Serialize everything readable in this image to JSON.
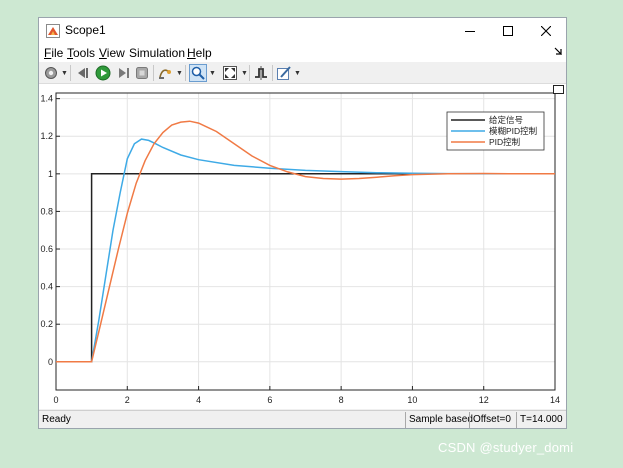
{
  "window": {
    "title": "Scope1",
    "controls": {
      "minimize": "—",
      "maximize": "☐",
      "close": "✕"
    }
  },
  "menu": {
    "items": [
      {
        "label": "File",
        "underline": "F",
        "rest": "ile"
      },
      {
        "label": "Tools",
        "underline": "T",
        "rest": "ools"
      },
      {
        "label": "View",
        "underline": "V",
        "rest": "iew"
      },
      {
        "label": "Simulation",
        "underline": "",
        "rest": "Simulation"
      },
      {
        "label": "Help",
        "underline": "H",
        "rest": "elp"
      }
    ]
  },
  "toolbar": {
    "icons": [
      "gear-icon",
      "rewind-icon",
      "run-icon",
      "step-forward-icon",
      "stop-icon",
      "highlight-icon",
      "zoom-icon",
      "fit-to-view-icon",
      "triggers-icon",
      "style-icon"
    ]
  },
  "status": {
    "state": "Ready",
    "sample_mode": "Sample based",
    "offset": "Offset=0",
    "time": "T=14.000"
  },
  "watermark": "CSDN @studyer_domi",
  "chart_data": {
    "type": "line",
    "xlim": [
      0,
      14
    ],
    "ylim": [
      -0.15,
      1.43
    ],
    "xticks": [
      0,
      2,
      4,
      6,
      8,
      10,
      12,
      14
    ],
    "yticks": [
      0,
      0.2,
      0.4,
      0.6,
      0.8,
      1,
      1.2,
      1.4
    ],
    "xtick_labels": [
      "0",
      "2",
      "4",
      "6",
      "8",
      "10",
      "12",
      "14"
    ],
    "ytick_labels": [
      "0",
      "0.2",
      "0.4",
      "0.6",
      "0.8",
      "1",
      "1.2",
      "1.4"
    ],
    "grid": true,
    "legend_placement": "top-right",
    "series": [
      {
        "name": "给定信号",
        "color": "#222222",
        "x": [
          0,
          1,
          1,
          14
        ],
        "y": [
          0,
          0,
          1,
          1
        ]
      },
      {
        "name": "模糊PID控制",
        "color": "#3eaae6",
        "x": [
          0,
          1,
          1.2,
          1.4,
          1.6,
          1.8,
          2.0,
          2.2,
          2.4,
          2.6,
          2.8,
          3.0,
          3.5,
          4.0,
          5.0,
          6.0,
          7.0,
          8.0,
          9.0,
          10.0,
          11.0,
          12.0,
          14.0
        ],
        "y": [
          0,
          0,
          0.22,
          0.46,
          0.7,
          0.9,
          1.08,
          1.16,
          1.185,
          1.178,
          1.16,
          1.14,
          1.1,
          1.075,
          1.045,
          1.03,
          1.018,
          1.012,
          1.006,
          1.003,
          1.001,
          1.0,
          1.0
        ]
      },
      {
        "name": "PID控制",
        "color": "#f07a45",
        "x": [
          0,
          1,
          1.25,
          1.5,
          1.75,
          2.0,
          2.25,
          2.5,
          2.75,
          3.0,
          3.25,
          3.5,
          3.75,
          4.0,
          4.5,
          5.0,
          5.5,
          6.0,
          6.5,
          7.0,
          7.5,
          8.0,
          8.5,
          9.0,
          9.5,
          10.0,
          11.0,
          12.0,
          13.0,
          14.0
        ],
        "y": [
          0,
          0,
          0.2,
          0.4,
          0.6,
          0.79,
          0.95,
          1.07,
          1.16,
          1.22,
          1.26,
          1.275,
          1.28,
          1.27,
          1.225,
          1.16,
          1.095,
          1.045,
          1.01,
          0.985,
          0.975,
          0.972,
          0.975,
          0.982,
          0.99,
          0.996,
          1.0,
          1.002,
          1.0,
          1.0
        ]
      }
    ]
  }
}
